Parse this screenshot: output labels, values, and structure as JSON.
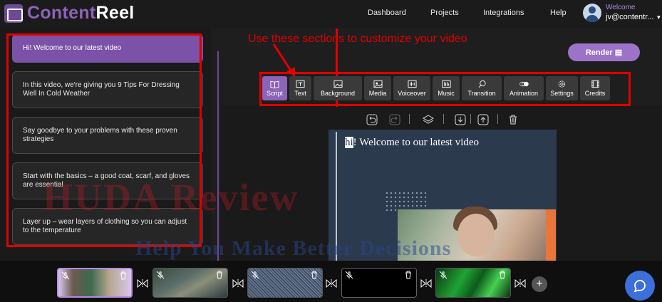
{
  "app": {
    "logo_part1": "Content",
    "logo_part2": "Reel"
  },
  "nav": {
    "items": [
      "Dashboard",
      "Projects",
      "Integrations",
      "Help"
    ]
  },
  "user": {
    "welcome": "Welcome",
    "email": "jv@contentr..."
  },
  "scenes": [
    "Hi! Welcome to our latest video",
    "In this video, we're giving you 9 Tips For Dressing Well In Cold Weather",
    "Say goodbye to your problems with these proven strategies",
    "Start with the basics – a good coat, scarf, and gloves are essential",
    "Layer up – wear layers of clothing so you can adjust to the temperature"
  ],
  "annotation": "Use these sections to customize your video",
  "render_button": "Render",
  "toolbar": {
    "items": [
      {
        "label": "Script",
        "icon": "book-icon"
      },
      {
        "label": "Text",
        "icon": "text-box-icon"
      },
      {
        "label": "Background",
        "icon": "image-icon"
      },
      {
        "label": "Media",
        "icon": "media-icon"
      },
      {
        "label": "Voiceover",
        "icon": "voiceover-icon"
      },
      {
        "label": "Music",
        "icon": "music-icon"
      },
      {
        "label": "Transition",
        "icon": "transition-icon"
      },
      {
        "label": "Animation",
        "icon": "animation-icon"
      },
      {
        "label": "Settings",
        "icon": "gear-icon"
      },
      {
        "label": "Credits",
        "icon": "film-icon"
      }
    ]
  },
  "preview": {
    "title_highlight": "hi",
    "title_rest": "! Welcome to our latest video"
  },
  "watermark": {
    "line1": "HUDA Review",
    "line2": "Help You Make Better Decisions"
  },
  "colors": {
    "accent": "#8c63b8",
    "annotation_red": "#e00000",
    "chat_blue": "#3d6fdc"
  }
}
